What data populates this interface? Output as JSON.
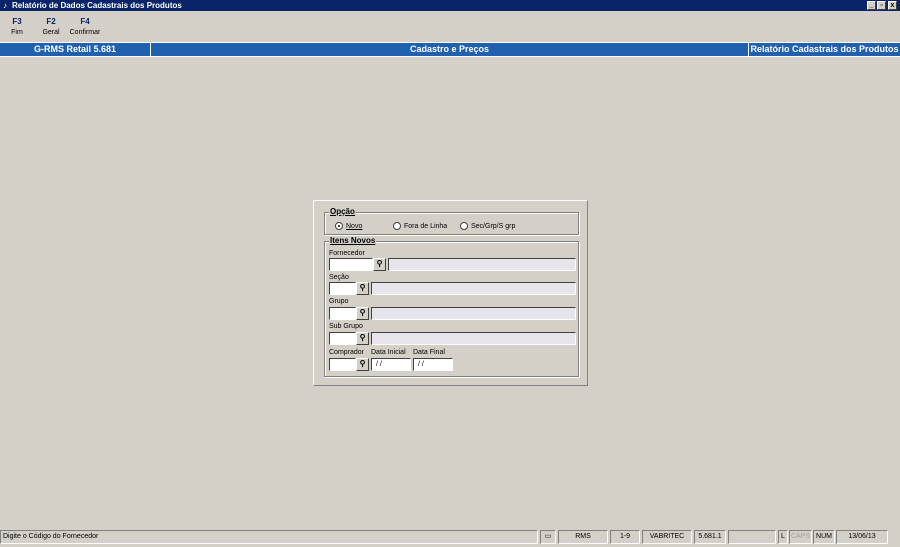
{
  "window": {
    "title": "Relatório de Dados Cadastrais dos Produtos",
    "controls": [
      "_",
      "▫",
      "x"
    ]
  },
  "toolbar": {
    "keys": [
      {
        "key": "F3",
        "label": "Fim"
      },
      {
        "key": "F2",
        "label": "Geral"
      },
      {
        "key": "F4",
        "label": "Confirmar"
      }
    ]
  },
  "header": {
    "left": "G-RMS Retail 5.681",
    "center": "Cadastro e Preços",
    "right": "Relatório Cadastrais dos Produtos"
  },
  "form": {
    "opcao": {
      "title": "Opção",
      "options": [
        "Novo",
        "Fora de Linha",
        "Sec/Grp/S grp"
      ],
      "selected": "Novo"
    },
    "itens": {
      "title": "Itens Novos",
      "fornecedor_label": "Fornecedor",
      "secao_label": "Seção",
      "grupo_label": "Grupo",
      "subgrupo_label": "Sub Grupo",
      "comprador_label": "Comprador",
      "data_inicial_label": "Data Inicial",
      "data_final_label": "Data Final",
      "data_inicial_value": " / /",
      "data_final_value": " / /"
    }
  },
  "statusbar": {
    "message": "Digite o Código do Fornecedor",
    "module": "RMS",
    "page": "1-9",
    "user": "VABRITEC",
    "version": "5.681.1",
    "l": "L",
    "caps": "CAPS",
    "num": "NUM",
    "date": "13/06/13"
  },
  "colors": {
    "title_bar": "#0a246a",
    "header_band": "#2060b0",
    "background": "#d4d0c8"
  }
}
